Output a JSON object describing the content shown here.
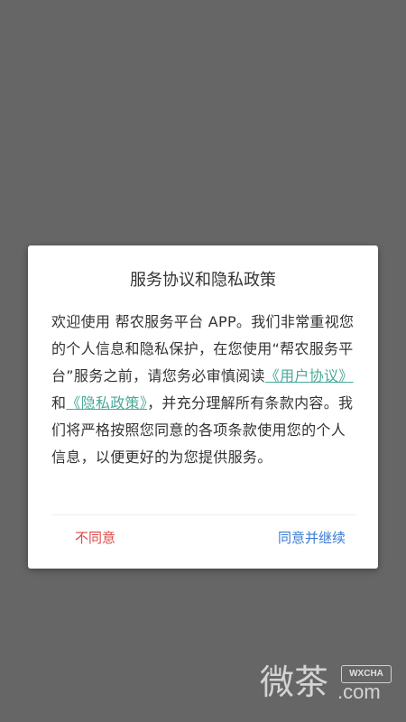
{
  "dialog": {
    "title": "服务协议和隐私政策",
    "body": {
      "part1": "欢迎使用 帮农服务平台 APP。我们非常重视您的个人信息和隐私保护，在您使用“帮农服务平台”服务之前，请您务必审慎阅读",
      "user_agreement_link": "《用户协议》",
      "and": "和",
      "privacy_policy_link": "《隐私政策》",
      "part2": "，并充分理解所有条款内容。我们将严格按照您同意的各项条款使用您的个人信息，以便更好的为您提供服务。"
    },
    "disagree_label": "不同意",
    "agree_label": "同意并继续"
  },
  "watermark": {
    "cn": "微茶",
    "badge": "WXCHA",
    "com": ".com"
  },
  "colors": {
    "overlay": "#666666",
    "link": "#4aaa9a",
    "disagree": "#e04545",
    "agree": "#3a7bd5"
  }
}
